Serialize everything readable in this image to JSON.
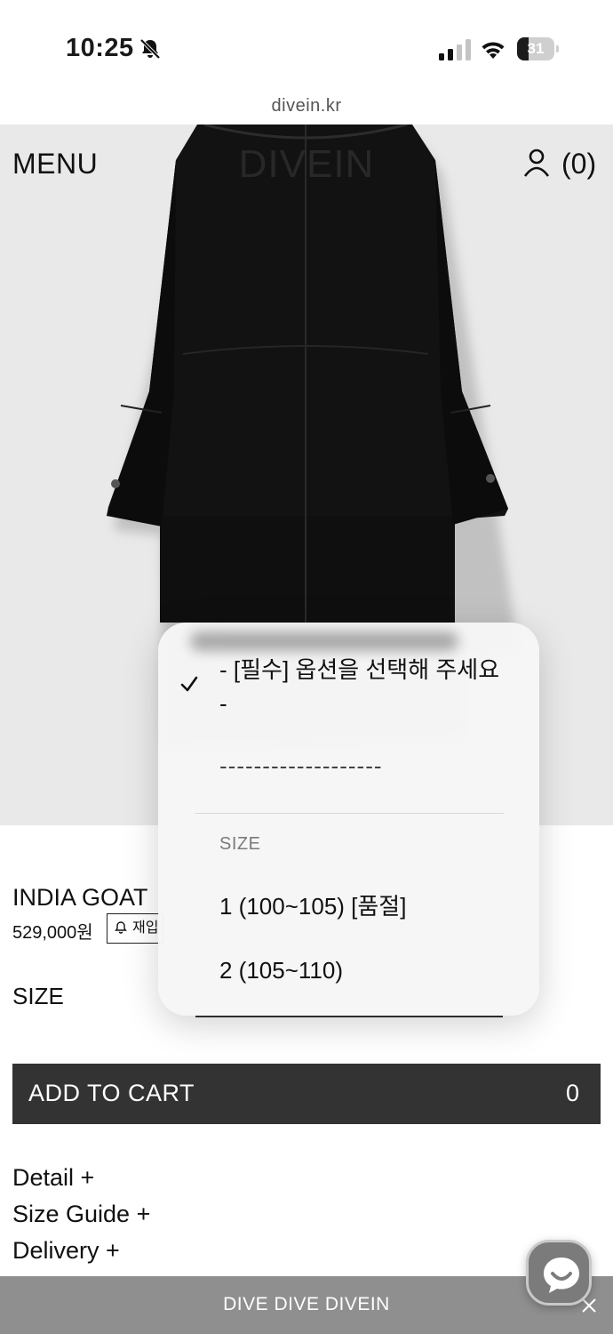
{
  "status_bar": {
    "time": "10:25",
    "battery_level": "31",
    "battery_fraction": 0.31
  },
  "browser": {
    "url": "divein.kr"
  },
  "header": {
    "menu_label": "MENU",
    "logo": "DIVEIN",
    "cart_count": "(0)"
  },
  "product": {
    "name": "INDIA GOAT",
    "price": "529,000원",
    "restock_label": "재입"
  },
  "option": {
    "size_label": "SIZE"
  },
  "cart": {
    "add_label": "ADD TO CART",
    "quantity": "0"
  },
  "info_links": [
    {
      "label": "Detail +"
    },
    {
      "label": "Size Guide +"
    },
    {
      "label": "Delivery +"
    }
  ],
  "footer": {
    "marquee": "DIVE DIVE DIVEIN"
  },
  "dropdown": {
    "selected": "- [필수] 옵션을 선택해 주세요 -",
    "separator": "-------------------",
    "group_label": "SIZE",
    "options": [
      {
        "label": "1 (100~105) [품절]"
      },
      {
        "label": "2 (105~110)"
      }
    ]
  },
  "icons": {
    "bell": "bell-slash-icon",
    "signal": "signal-icon",
    "wifi": "wifi-icon",
    "user": "user-icon",
    "check": "checkmark-icon",
    "chat": "chat-icon",
    "close": "close-icon"
  },
  "colors": {
    "cart_button": "#333333",
    "footer": "#8f8f8f",
    "hero_bg": "#e9e9e9"
  }
}
